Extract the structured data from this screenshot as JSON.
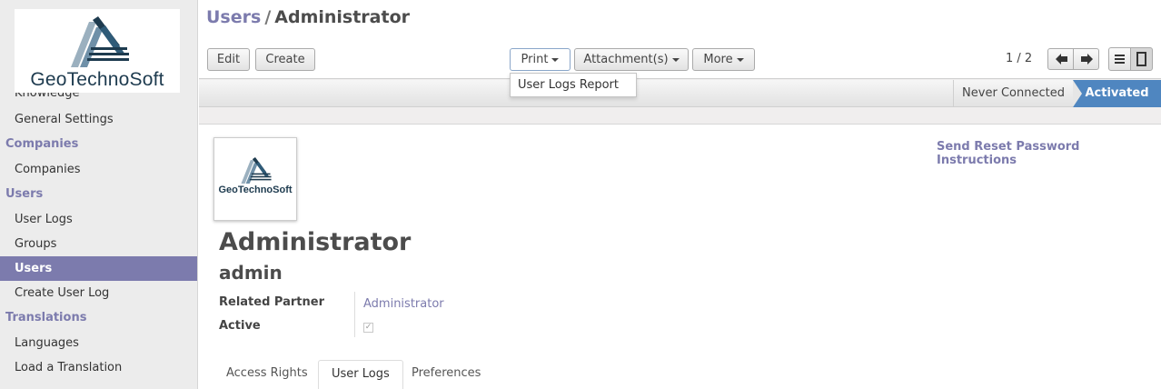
{
  "sidebar": {
    "logo_text": "GeoTechnoSoft",
    "items": [
      {
        "type": "item",
        "label": "Knowledge",
        "clipped": true
      },
      {
        "type": "item",
        "label": "General Settings"
      },
      {
        "type": "header",
        "label": "Companies"
      },
      {
        "type": "item",
        "label": "Companies"
      },
      {
        "type": "header",
        "label": "Users"
      },
      {
        "type": "item",
        "label": "User Logs"
      },
      {
        "type": "item",
        "label": "Groups"
      },
      {
        "type": "item",
        "label": "Users",
        "active": true
      },
      {
        "type": "item",
        "label": "Create User Log"
      },
      {
        "type": "header",
        "label": "Translations"
      },
      {
        "type": "item",
        "label": "Languages"
      },
      {
        "type": "item",
        "label": "Load a Translation"
      }
    ]
  },
  "breadcrumb": {
    "parent": "Users",
    "separator": "/",
    "current": "Administrator"
  },
  "toolbar": {
    "edit": "Edit",
    "create": "Create",
    "print": "Print",
    "attachments": "Attachment(s)",
    "more": "More"
  },
  "print_menu": {
    "items": [
      "User Logs Report"
    ]
  },
  "pager": {
    "value": "1 / 2"
  },
  "statusbar": {
    "never_connected": "Never Connected",
    "activated": "Activated"
  },
  "form": {
    "reset_link": "Send Reset Password Instructions",
    "avatar_text": "GeoTechnoSoft",
    "name": "Administrator",
    "login": "admin",
    "related_partner_label": "Related Partner",
    "related_partner_value": "Administrator",
    "active_label": "Active",
    "active_checked": true
  },
  "tabs": [
    {
      "label": "Access Rights"
    },
    {
      "label": "User Logs",
      "active": true
    },
    {
      "label": "Preferences"
    }
  ],
  "colors": {
    "accent": "#7c7bad",
    "status_active": "#4f86c0",
    "logo": "#1e3b4f"
  }
}
